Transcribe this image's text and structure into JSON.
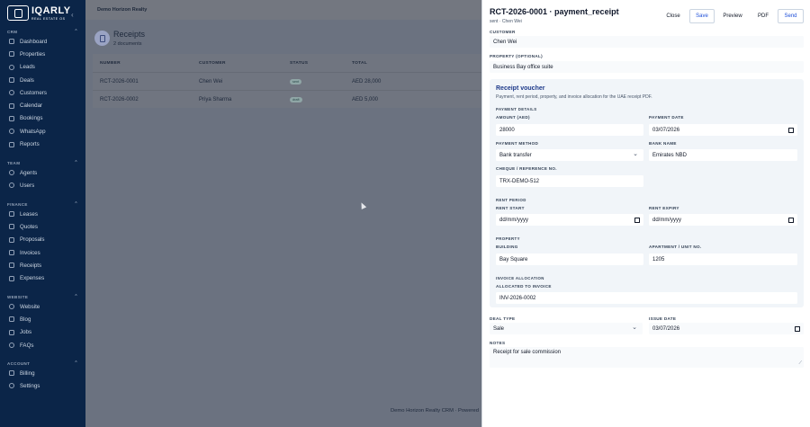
{
  "brand": {
    "name": "IQARLY",
    "subtitle": "REAL ESTATE OS"
  },
  "sidebar": {
    "sections": [
      {
        "title": "CRM",
        "items": [
          "Dashboard",
          "Properties",
          "Leads",
          "Deals",
          "Customers",
          "Calendar",
          "Bookings",
          "WhatsApp",
          "Reports"
        ]
      },
      {
        "title": "TEAM",
        "items": [
          "Agents",
          "Users"
        ]
      },
      {
        "title": "FINANCE",
        "items": [
          "Leases",
          "Quotes",
          "Proposals",
          "Invoices",
          "Receipts",
          "Expenses"
        ]
      },
      {
        "title": "WEBSITE",
        "items": [
          "Website",
          "Blog",
          "Jobs",
          "FAQs"
        ]
      },
      {
        "title": "ACCOUNT",
        "items": [
          "Billing",
          "Settings"
        ]
      }
    ]
  },
  "topbar": {
    "org": "Demo Horizon Realty"
  },
  "page": {
    "title": "Receipts",
    "subtitle": "2 documents"
  },
  "table": {
    "headers": [
      "NUMBER",
      "CUSTOMER",
      "STATUS",
      "TOTAL"
    ],
    "rows": [
      {
        "number": "RCT-2026-0001",
        "customer": "Chen Wei",
        "status": "sent",
        "total": "AED 28,000"
      },
      {
        "number": "RCT-2026-0002",
        "customer": "Priya Sharma",
        "status": "draft",
        "total": "AED 5,000"
      }
    ]
  },
  "footer": {
    "text": "Demo Horizon Realty CRM · Powered"
  },
  "drawer": {
    "title": "RCT-2026-0001 · payment_receipt",
    "subtitle": "sent · Chen Wei",
    "buttons": {
      "close": "Close",
      "save": "Save",
      "preview": "Preview",
      "pdf": "PDF",
      "send": "Send"
    },
    "customer": {
      "label": "CUSTOMER",
      "value": "Chen Wei"
    },
    "property": {
      "label": "PROPERTY (OPTIONAL)",
      "value": "Business Bay office suite"
    },
    "voucher": {
      "title": "Receipt voucher",
      "description": "Payment, rent period, property, and invoice allocation for the UAE receipt PDF.",
      "payment_details": "PAYMENT DETAILS",
      "amount": {
        "label": "AMOUNT (AED)",
        "value": "28000"
      },
      "payment_date": {
        "label": "PAYMENT DATE",
        "value": "03/07/2026"
      },
      "payment_method": {
        "label": "PAYMENT METHOD",
        "value": "Bank transfer"
      },
      "bank_name": {
        "label": "BANK NAME",
        "value": "Emirates NBD"
      },
      "reference": {
        "label": "CHEQUE / REFERENCE NO.",
        "value": "TRX-DEMO-512"
      },
      "rent_period": "RENT PERIOD",
      "rent_start": {
        "label": "RENT START",
        "value": "dd/mm/yyyy"
      },
      "rent_expiry": {
        "label": "RENT EXPIRY",
        "value": "dd/mm/yyyy"
      },
      "property_section": "PROPERTY",
      "building": {
        "label": "BUILDING",
        "value": "Bay Square"
      },
      "unit": {
        "label": "APARTMENT / UNIT NO.",
        "value": "1205"
      },
      "invoice_allocation": "INVOICE ALLOCATION",
      "allocated": {
        "label": "ALLOCATED TO INVOICE",
        "value": "INV-2026-0002"
      }
    },
    "deal_type": {
      "label": "DEAL TYPE",
      "value": "Sale"
    },
    "issue_date": {
      "label": "ISSUE DATE",
      "value": "03/07/2026"
    },
    "notes": {
      "label": "NOTES",
      "value": "Receipt for sale commission"
    }
  }
}
